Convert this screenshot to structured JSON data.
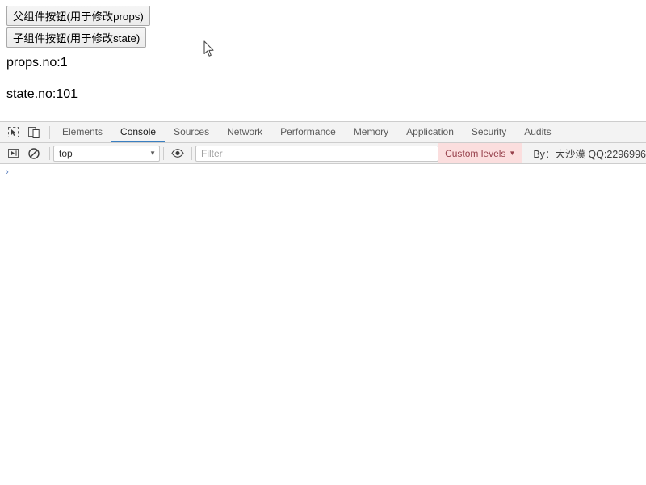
{
  "page": {
    "buttons": [
      {
        "label": "父组件按钮(用于修改props)",
        "name": "parent-component-button"
      },
      {
        "label": "子组件按钮(用于修改state)",
        "name": "child-component-button"
      }
    ],
    "paragraphs": [
      {
        "text": "props.no:1"
      },
      {
        "text": "state.no:101"
      }
    ]
  },
  "devtools": {
    "icons": {
      "inspect": "inspect-element-icon",
      "device": "device-toolbar-icon",
      "execute": "execute-snippet-icon",
      "clear": "clear-console-icon",
      "eye": "console-sidebar-eye-icon"
    },
    "tabs": [
      {
        "label": "Elements",
        "active": false
      },
      {
        "label": "Console",
        "active": true
      },
      {
        "label": "Sources",
        "active": false
      },
      {
        "label": "Network",
        "active": false
      },
      {
        "label": "Performance",
        "active": false
      },
      {
        "label": "Memory",
        "active": false
      },
      {
        "label": "Application",
        "active": false
      },
      {
        "label": "Security",
        "active": false
      },
      {
        "label": "Audits",
        "active": false
      }
    ],
    "filterbar": {
      "context_value": "top",
      "context_arrow": "▼",
      "filter_placeholder": "Filter",
      "filter_value": "",
      "levels_label": "Custom levels",
      "levels_arrow": "▼",
      "credit_text": "By：大沙漠 QQ:2296996"
    },
    "console": {
      "prompt_symbol": "›",
      "prompt_value": ""
    },
    "colors": {
      "active_tab_underline": "#3a7fc1",
      "levels_chip_bg": "#fbdede",
      "levels_chip_fg": "#96404b",
      "toolbar_bg": "#f3f3f3",
      "border": "#cdcdcd",
      "prompt_chevron": "#5a7fc0"
    }
  }
}
